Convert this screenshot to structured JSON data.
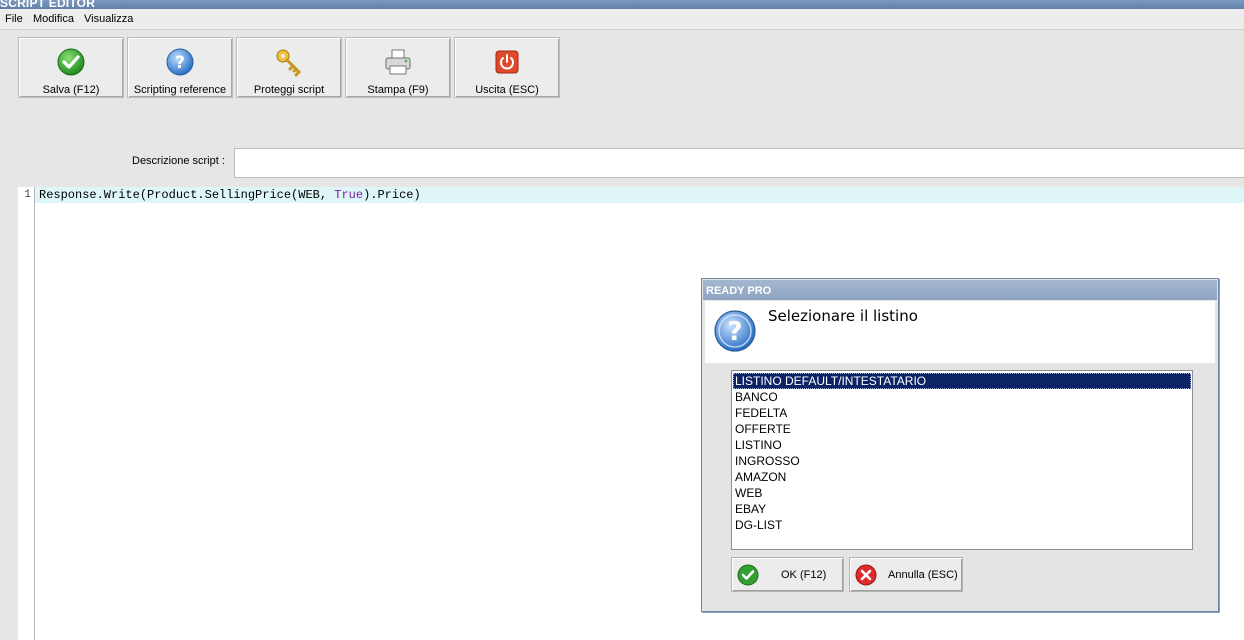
{
  "window": {
    "title": "SCRIPT EDITOR"
  },
  "menu": {
    "items": [
      "File",
      "Modifica",
      "Visualizza"
    ]
  },
  "toolbar": {
    "buttons": [
      {
        "label": "Salva (F12)",
        "icon": "check-icon"
      },
      {
        "label": "Scripting reference",
        "icon": "help-icon"
      },
      {
        "label": "Proteggi script",
        "icon": "key-icon"
      },
      {
        "label": "Stampa (F9)",
        "icon": "printer-icon"
      },
      {
        "label": "Uscita (ESC)",
        "icon": "power-icon"
      }
    ]
  },
  "description": {
    "label": "Descrizione script :",
    "value": ""
  },
  "editor": {
    "line_number": "1",
    "code_before": "Response.Write(Product.SellingPrice(WEB, ",
    "code_keyword": "True",
    "code_after": ").Price)"
  },
  "dialog": {
    "title": "READY PRO",
    "message": "Selezionare il listino",
    "items": [
      "LISTINO DEFAULT/INTESTATARIO",
      "BANCO",
      "FEDELTA",
      "OFFERTE",
      "LISTINO",
      "INGROSSO",
      "AMAZON",
      "WEB",
      "EBAY",
      "DG-LIST"
    ],
    "selected_index": 0,
    "ok_label": "OK (F12)",
    "cancel_label": "Annulla (ESC)"
  },
  "colors": {
    "selection": "#0c2466",
    "current_line": "#dff6f8",
    "keyword": "#7a1fa2"
  }
}
